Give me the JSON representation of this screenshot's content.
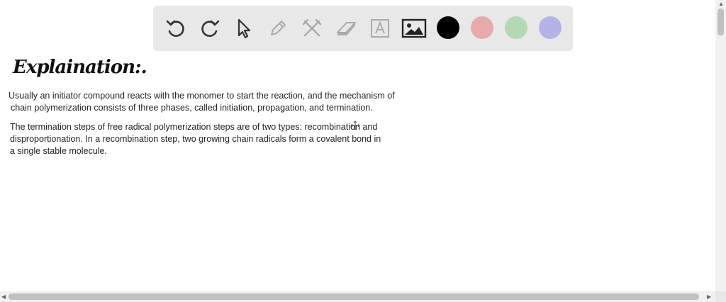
{
  "toolbar": {
    "tools": [
      {
        "icon": "undo-icon"
      },
      {
        "icon": "redo-icon"
      },
      {
        "icon": "cursor-icon"
      },
      {
        "icon": "pen-icon"
      },
      {
        "icon": "tools-icon"
      },
      {
        "icon": "eraser-icon"
      },
      {
        "icon": "text-icon",
        "glyph": "A"
      },
      {
        "icon": "image-icon"
      }
    ],
    "colors": [
      "#000000",
      "#e8a9a9",
      "#b3d9b3",
      "#b3b3e8"
    ]
  },
  "content": {
    "heading": "Explaination:.",
    "para1_line1": "Usually an initiator compound reacts with the monomer to start the reaction, and the mechanism of",
    "para1_line2": "chain polymerization consists of three phases, called initiation, propagation, and termination.",
    "para2_line1": "The termination steps of free radical polymerization steps are of two types: recombination and",
    "para2_line2": "disproportionation. In a recombination step, two growing chain radicals form a covalent bond in",
    "para2_line3": "a single stable molecule."
  }
}
